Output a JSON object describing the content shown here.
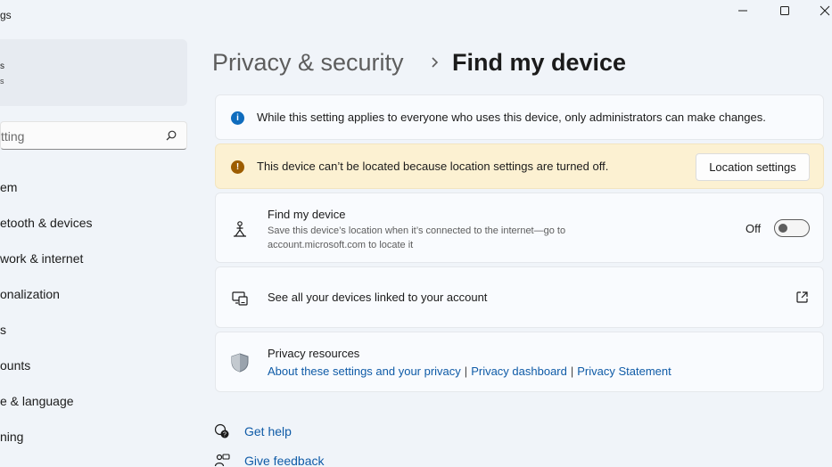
{
  "window": {
    "title_fragment": "gs"
  },
  "sidebar": {
    "profile": {
      "line1": "s",
      "line2": "s"
    },
    "search": {
      "value": "tting"
    },
    "items": [
      {
        "label": "em"
      },
      {
        "label": "etooth & devices"
      },
      {
        "label": "work & internet"
      },
      {
        "label": "onalization"
      },
      {
        "label": "s"
      },
      {
        "label": "ounts"
      },
      {
        "label": "e & language"
      },
      {
        "label": "ning"
      }
    ]
  },
  "header": {
    "breadcrumb_parent": "Privacy & security",
    "title": "Find my device"
  },
  "main": {
    "info_banner": {
      "text": "While this setting applies to everyone who uses this device, only administrators can make changes."
    },
    "warning_banner": {
      "text": "This device can’t be located because location settings are turned off.",
      "button_label": "Location settings"
    },
    "find_device": {
      "title": "Find my device",
      "description": "Save this device’s location when it’s connected to the internet—go to account.microsoft.com to locate it",
      "toggle_label": "Off",
      "toggle_state": "off"
    },
    "linked_devices": {
      "label": "See all your devices linked to your account"
    },
    "privacy_resources": {
      "title": "Privacy resources",
      "links": [
        "About these settings and your privacy",
        "Privacy dashboard",
        "Privacy Statement"
      ],
      "separator": "|"
    }
  },
  "help": {
    "get_help": "Get help",
    "give_feedback": "Give feedback"
  },
  "colors": {
    "accent": "#0f6cbd",
    "link": "#0f5ba7",
    "warning_bg": "#fcf1d2",
    "warning_icon": "#9d5d00"
  }
}
